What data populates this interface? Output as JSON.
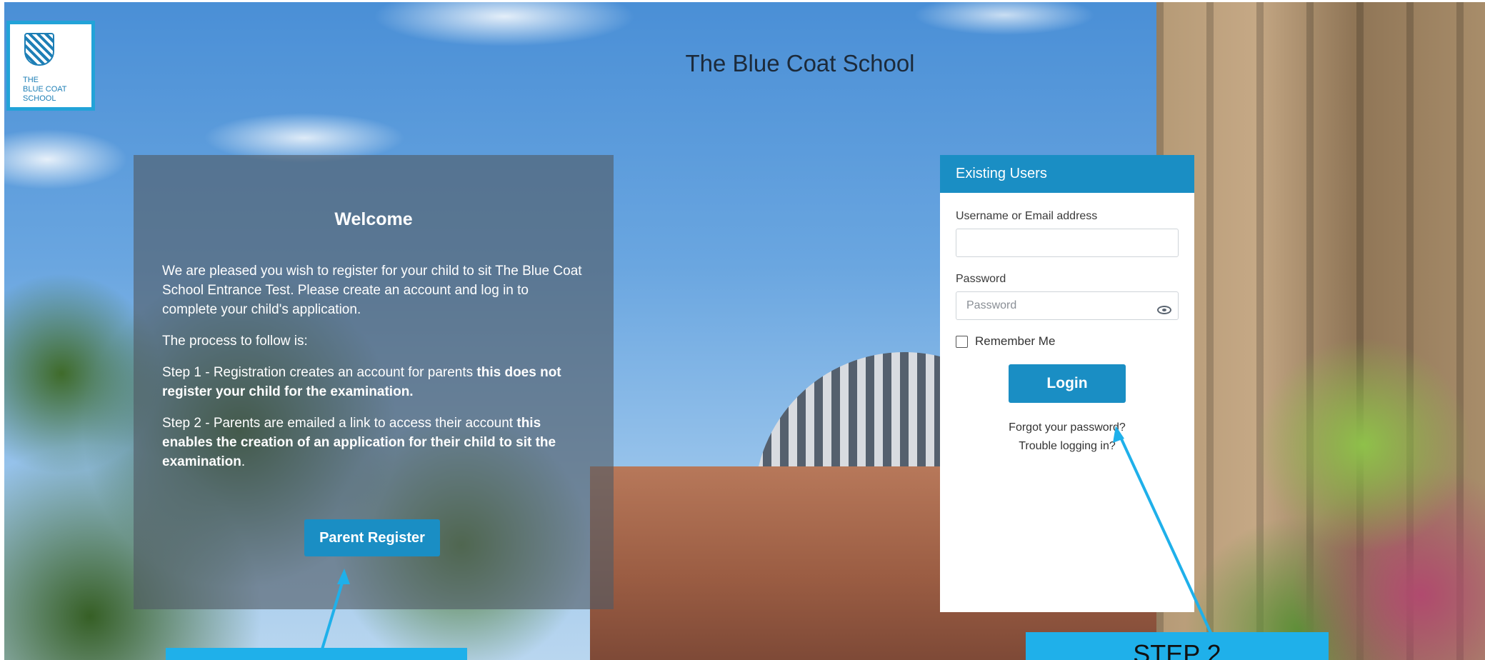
{
  "site": {
    "title": "The Blue Coat School",
    "logo_lines": [
      "THE",
      "BLUE COAT",
      "SCHOOL"
    ]
  },
  "welcome": {
    "heading": "Welcome",
    "intro": "We are pleased you wish to register for your child to sit The Blue Coat School Entrance Test. Please create an account and log in to complete your child's application.",
    "process_label": "The process to follow is:",
    "step1_text": "Step 1 - Registration creates an account for parents ",
    "step1_bold": "this does not register your child for the examination.",
    "step2_text": "Step 2 - Parents are emailed a link to access their account ",
    "step2_bold": "this enables the creation of an application for their child to sit the examination",
    "step2_end": ".",
    "register_label": "Parent Register"
  },
  "login": {
    "header": "Existing Users",
    "username_label": "Username or Email address",
    "username_value": "",
    "password_label": "Password",
    "password_placeholder": "Password",
    "remember_label": "Remember Me",
    "login_label": "Login",
    "forgot_link": "Forgot your password?",
    "trouble_link": "Trouble logging in?"
  },
  "annotations": {
    "step2_label": "STEP 2"
  },
  "colors": {
    "accent": "#1a8ec4",
    "annotation": "#1fb0ea"
  }
}
